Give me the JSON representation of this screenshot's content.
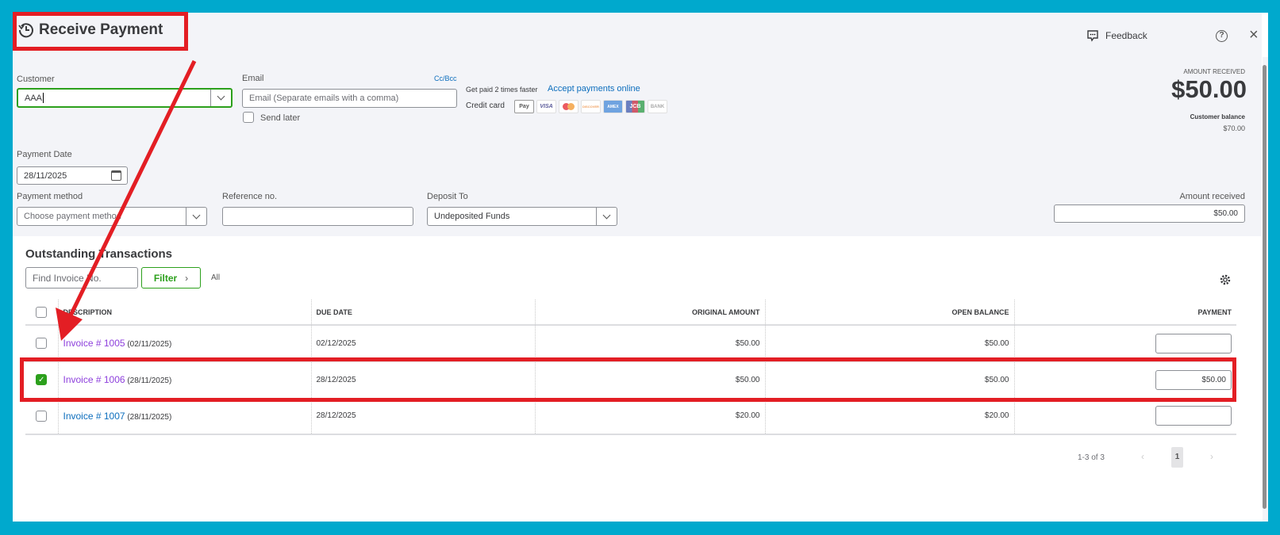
{
  "title": "Receive Payment",
  "header": {
    "feedback": "Feedback"
  },
  "customer": {
    "label": "Customer",
    "value": "AAA"
  },
  "email": {
    "label": "Email",
    "placeholder": "Email (Separate emails with a comma)",
    "ccbcc": "Cc/Bcc",
    "send_later": "Send later"
  },
  "promo": {
    "text": "Get paid 2 times faster",
    "link": "Accept payments online",
    "credit_card": "Credit card",
    "cards": [
      "Pay",
      "VISA",
      "MC",
      "DISCOVER",
      "AMEX",
      "JCB",
      "BANK"
    ]
  },
  "summary": {
    "amount_label": "AMOUNT RECEIVED",
    "amount": "$50.00",
    "balance_label": "Customer balance",
    "balance": "$70.00"
  },
  "payment_date": {
    "label": "Payment Date",
    "value": "28/11/2025"
  },
  "payment_method": {
    "label": "Payment method",
    "placeholder": "Choose payment method"
  },
  "reference": {
    "label": "Reference no."
  },
  "deposit": {
    "label": "Deposit To",
    "value": "Undeposited Funds"
  },
  "amount_received": {
    "label": "Amount received",
    "value": "$50.00"
  },
  "outstanding": {
    "title": "Outstanding Transactions",
    "find_placeholder": "Find Invoice No.",
    "filter": "Filter",
    "all": "All"
  },
  "table": {
    "headers": [
      "DESCRIPTION",
      "DUE DATE",
      "ORIGINAL AMOUNT",
      "OPEN BALANCE",
      "PAYMENT"
    ],
    "rows": [
      {
        "invoice": "Invoice # 1005",
        "date": "(02/11/2025)",
        "due": "02/12/2025",
        "original": "$50.00",
        "open": "$50.00",
        "payment": "",
        "checked": false
      },
      {
        "invoice": "Invoice # 1006",
        "date": "(28/11/2025)",
        "due": "28/12/2025",
        "original": "$50.00",
        "open": "$50.00",
        "payment": "$50.00",
        "checked": true
      },
      {
        "invoice": "Invoice # 1007",
        "date": "(28/11/2025)",
        "due": "28/12/2025",
        "original": "$20.00",
        "open": "$20.00",
        "payment": "",
        "checked": false
      }
    ]
  },
  "pagination": {
    "range": "1-3 of 3",
    "page": "1"
  },
  "colors": {
    "annotation": "#e31e24",
    "frame": "#00a9cd",
    "green": "#2ca01c",
    "visited": "#8d3fdc",
    "link": "#0d6ebd"
  }
}
